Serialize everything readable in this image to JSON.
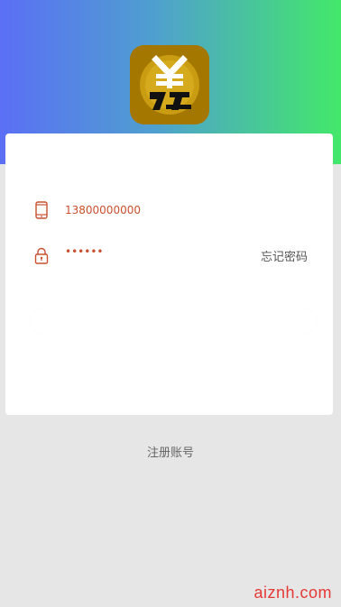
{
  "login": {
    "phone_value": "13800000000",
    "password_mask": "••••••",
    "forgot_label": "忘记密码",
    "submit_label": ""
  },
  "register_label": "注册账号",
  "watermark": "aiznh.com",
  "icons": {
    "logo": "yuan-coin-logo-icon",
    "phone": "phone-icon",
    "lock": "lock-icon"
  },
  "colors": {
    "gradient_start": "#5b6ff5",
    "gradient_end": "#43e86a",
    "accent": "#c9502f",
    "watermark": "#e53935"
  }
}
